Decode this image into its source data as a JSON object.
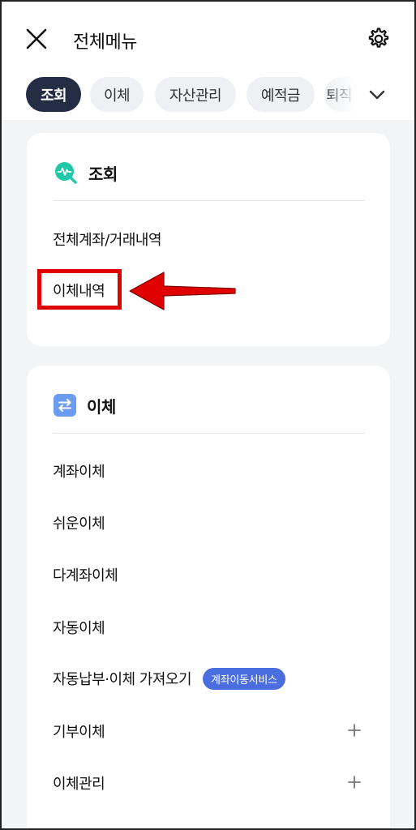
{
  "header": {
    "title": "전체메뉴"
  },
  "tabs": [
    {
      "label": "조회",
      "active": true
    },
    {
      "label": "이체",
      "active": false
    },
    {
      "label": "자산관리",
      "active": false
    },
    {
      "label": "예적금",
      "active": false
    },
    {
      "label": "퇴직",
      "active": false
    }
  ],
  "sections": {
    "inquiry": {
      "title": "조회",
      "icon": "search-chart-icon",
      "items": [
        "전체계좌/거래내역",
        "이체내역"
      ]
    },
    "transfer": {
      "title": "이체",
      "icon": "transfer-arrows-icon",
      "items": [
        {
          "label": "계좌이체"
        },
        {
          "label": "쉬운이체"
        },
        {
          "label": "다계좌이체"
        },
        {
          "label": "자동이체"
        },
        {
          "label": "자동납부·이체 가져오기",
          "badge": "계좌이동서비스"
        },
        {
          "label": "기부이체",
          "expandable": true
        },
        {
          "label": "이체관리",
          "expandable": true
        }
      ]
    }
  },
  "colors": {
    "active_tab": "#252d45",
    "badge": "#4a6ee0",
    "inquiry_icon": "#1fc9a8",
    "transfer_icon": "#6b9cf2",
    "highlight": "#e00000"
  }
}
